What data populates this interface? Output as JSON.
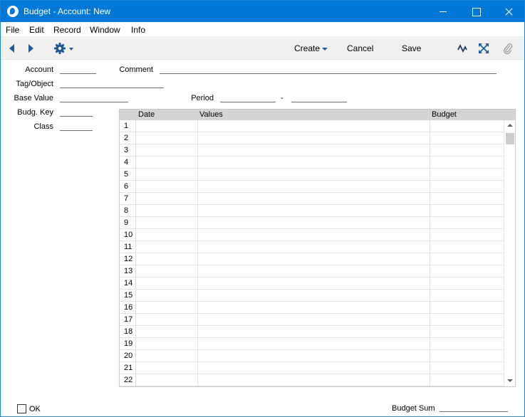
{
  "window": {
    "title": "Budget - Account: New"
  },
  "menu": [
    "File",
    "Edit",
    "Record",
    "Window",
    "Info"
  ],
  "toolbar": {
    "create_label": "Create",
    "cancel_label": "Cancel",
    "save_label": "Save"
  },
  "form": {
    "account_label": "Account",
    "comment_label": "Comment",
    "tag_label": "Tag/Object",
    "base_value_label": "Base Value",
    "period_label": "Period",
    "period_separator": "-",
    "budg_key_label": "Budg. Key",
    "class_label": "Class"
  },
  "grid": {
    "columns": [
      "Date",
      "Values",
      "Budget"
    ],
    "rows": [
      "1",
      "2",
      "3",
      "4",
      "5",
      "6",
      "7",
      "8",
      "9",
      "10",
      "11",
      "12",
      "13",
      "14",
      "15",
      "16",
      "17",
      "18",
      "19",
      "20",
      "21",
      "22"
    ]
  },
  "footer": {
    "ok_label": "OK",
    "budget_sum_label": "Budget Sum"
  }
}
